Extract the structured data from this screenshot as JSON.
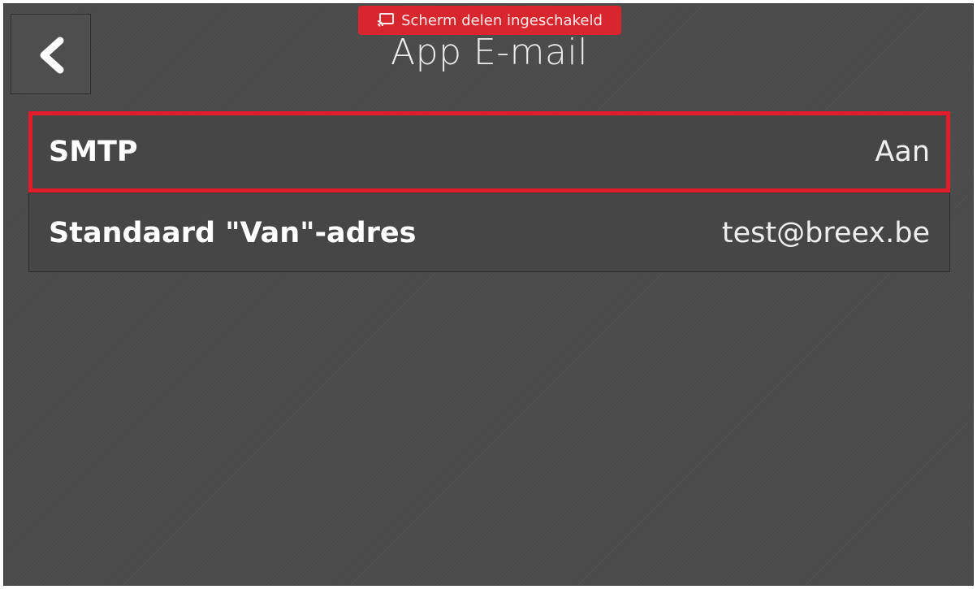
{
  "banner": {
    "text": "Scherm delen ingeschakeld",
    "icon": "screen-cast-icon",
    "color": "#d8262f"
  },
  "header": {
    "title": "App E-mail",
    "back_icon": "chevron-left-icon"
  },
  "settings": [
    {
      "label": "SMTP",
      "value": "Aan",
      "highlighted": true
    },
    {
      "label": "Standaard \"Van\"-adres",
      "value": "test@breex.be",
      "highlighted": false
    }
  ],
  "colors": {
    "background": "#4a4a4a",
    "highlight": "#e21c2a"
  }
}
